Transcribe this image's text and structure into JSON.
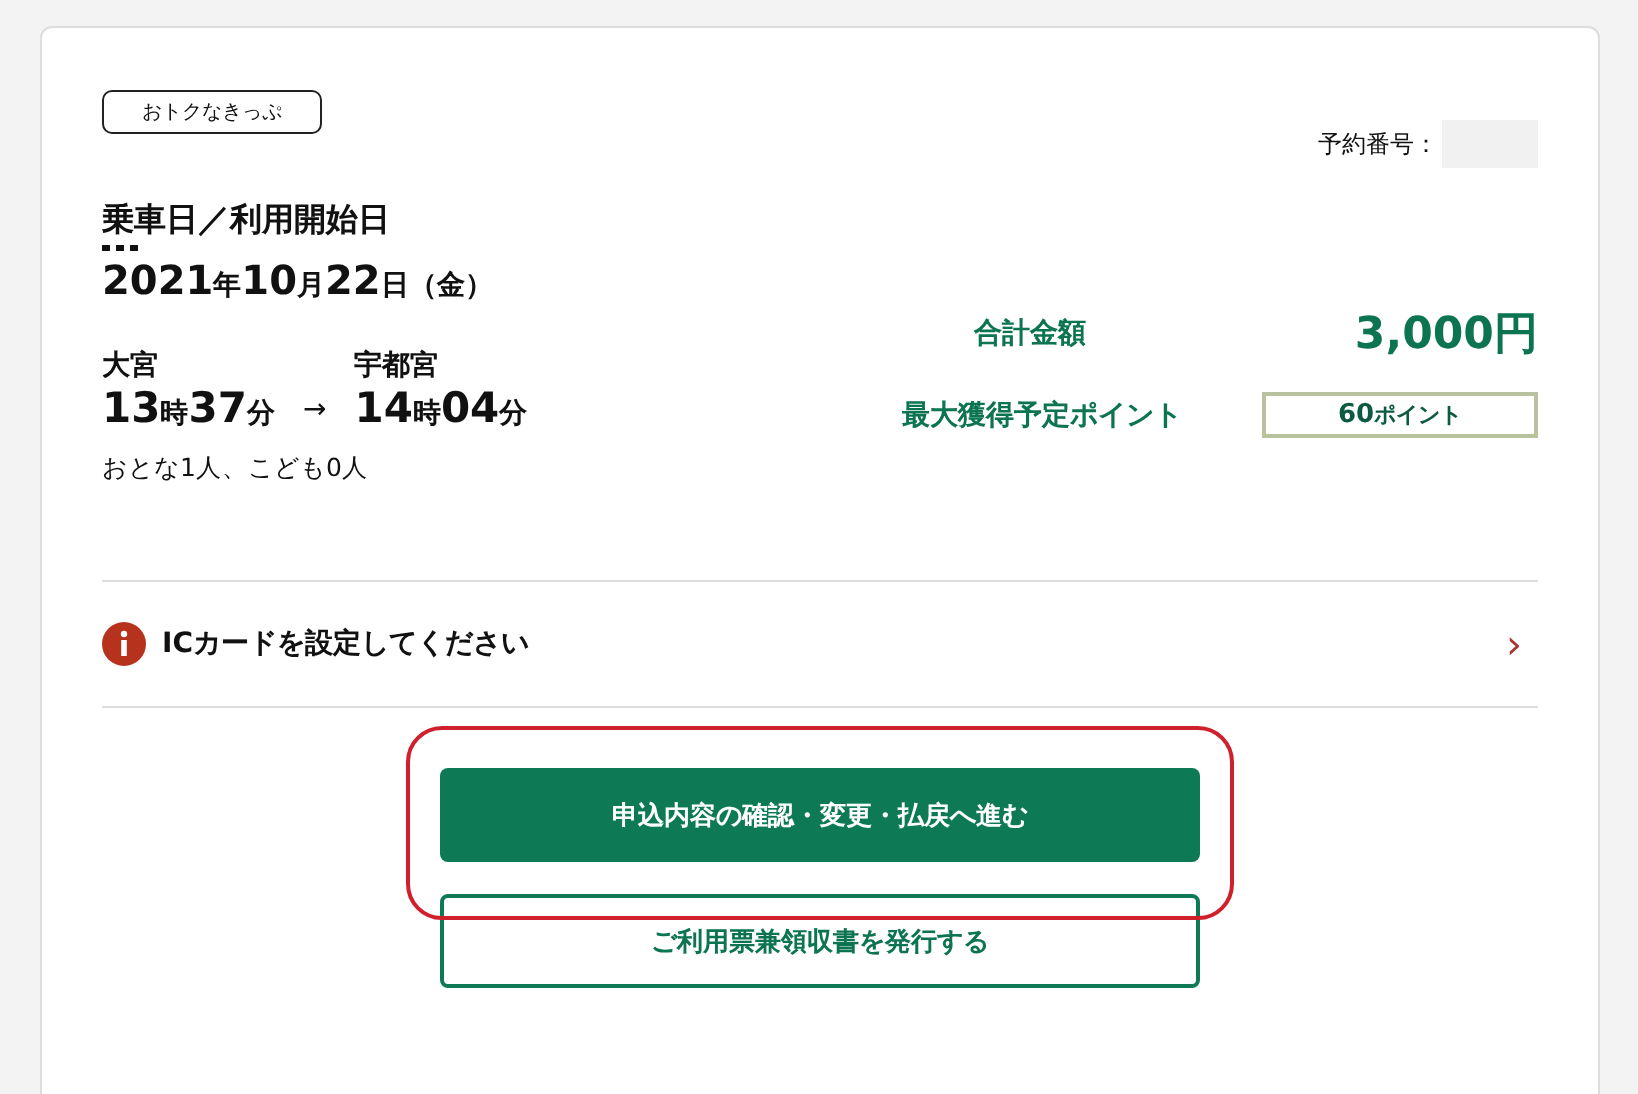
{
  "badge": "おトクなきっぷ",
  "reservation": {
    "label": "予約番号："
  },
  "date": {
    "heading": "乗車日／利用開始日",
    "year": "2021",
    "year_unit": "年",
    "month": "10",
    "month_unit": "月",
    "day": "22",
    "day_unit": "日",
    "weekday": "（金）"
  },
  "trip": {
    "from": "大宮",
    "to": "宇都宮",
    "dep_h": "13",
    "dep_hour_unit": "時",
    "dep_m": "37",
    "dep_min_unit": "分",
    "arrow": "→",
    "arr_h": "14",
    "arr_hour_unit": "時",
    "arr_m": "04",
    "arr_min_unit": "分"
  },
  "passengers": "おとな1人、こども0人",
  "total": {
    "label": "合計金額",
    "value": "3,000円"
  },
  "points": {
    "label": "最大獲得予定ポイント",
    "value": "60",
    "unit": "ポイント"
  },
  "notice": {
    "text": "ICカードを設定してください",
    "chevron": "›"
  },
  "buttons": [
    {
      "label": "申込内容の確認・変更・払戻へ進む",
      "kind": "primary",
      "highlighted": true
    },
    {
      "label": "ご利用票兼領収書を発行する",
      "kind": "outline",
      "highlighted": false
    }
  ]
}
